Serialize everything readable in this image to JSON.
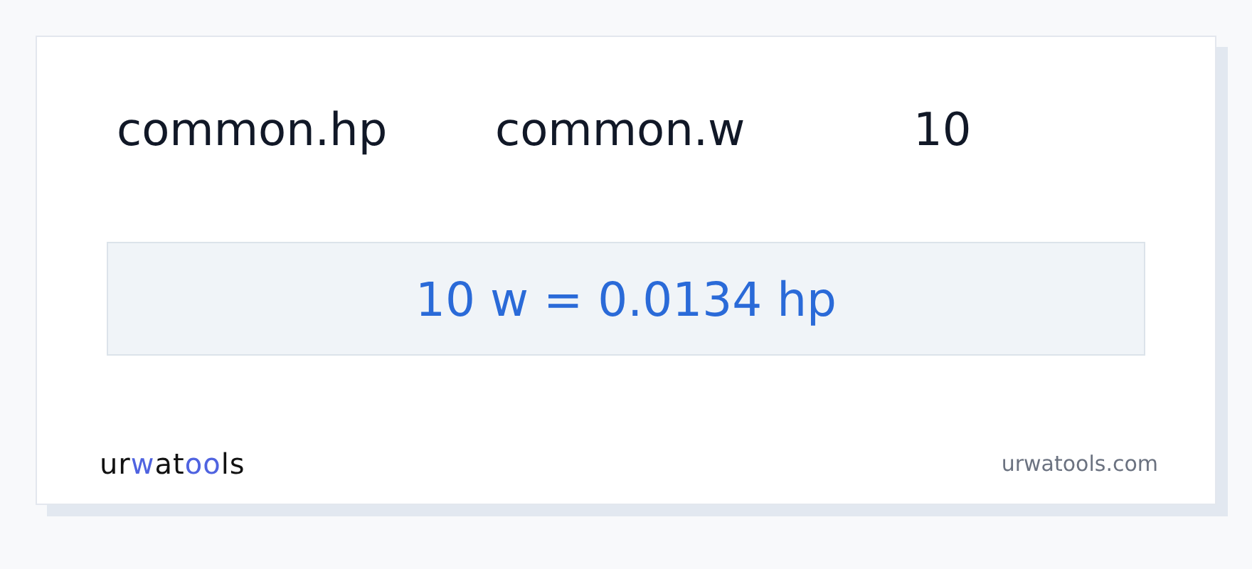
{
  "inputs": [
    "common.hp",
    "common.w",
    "10"
  ],
  "result": "10 w = 0.0134 hp",
  "logo": [
    {
      "text": "ur",
      "accent": false
    },
    {
      "text": "w",
      "accent": true
    },
    {
      "text": "at",
      "accent": false
    },
    {
      "text": "oo",
      "accent": true
    },
    {
      "text": "ls",
      "accent": false
    }
  ],
  "site": "urwatools.com"
}
